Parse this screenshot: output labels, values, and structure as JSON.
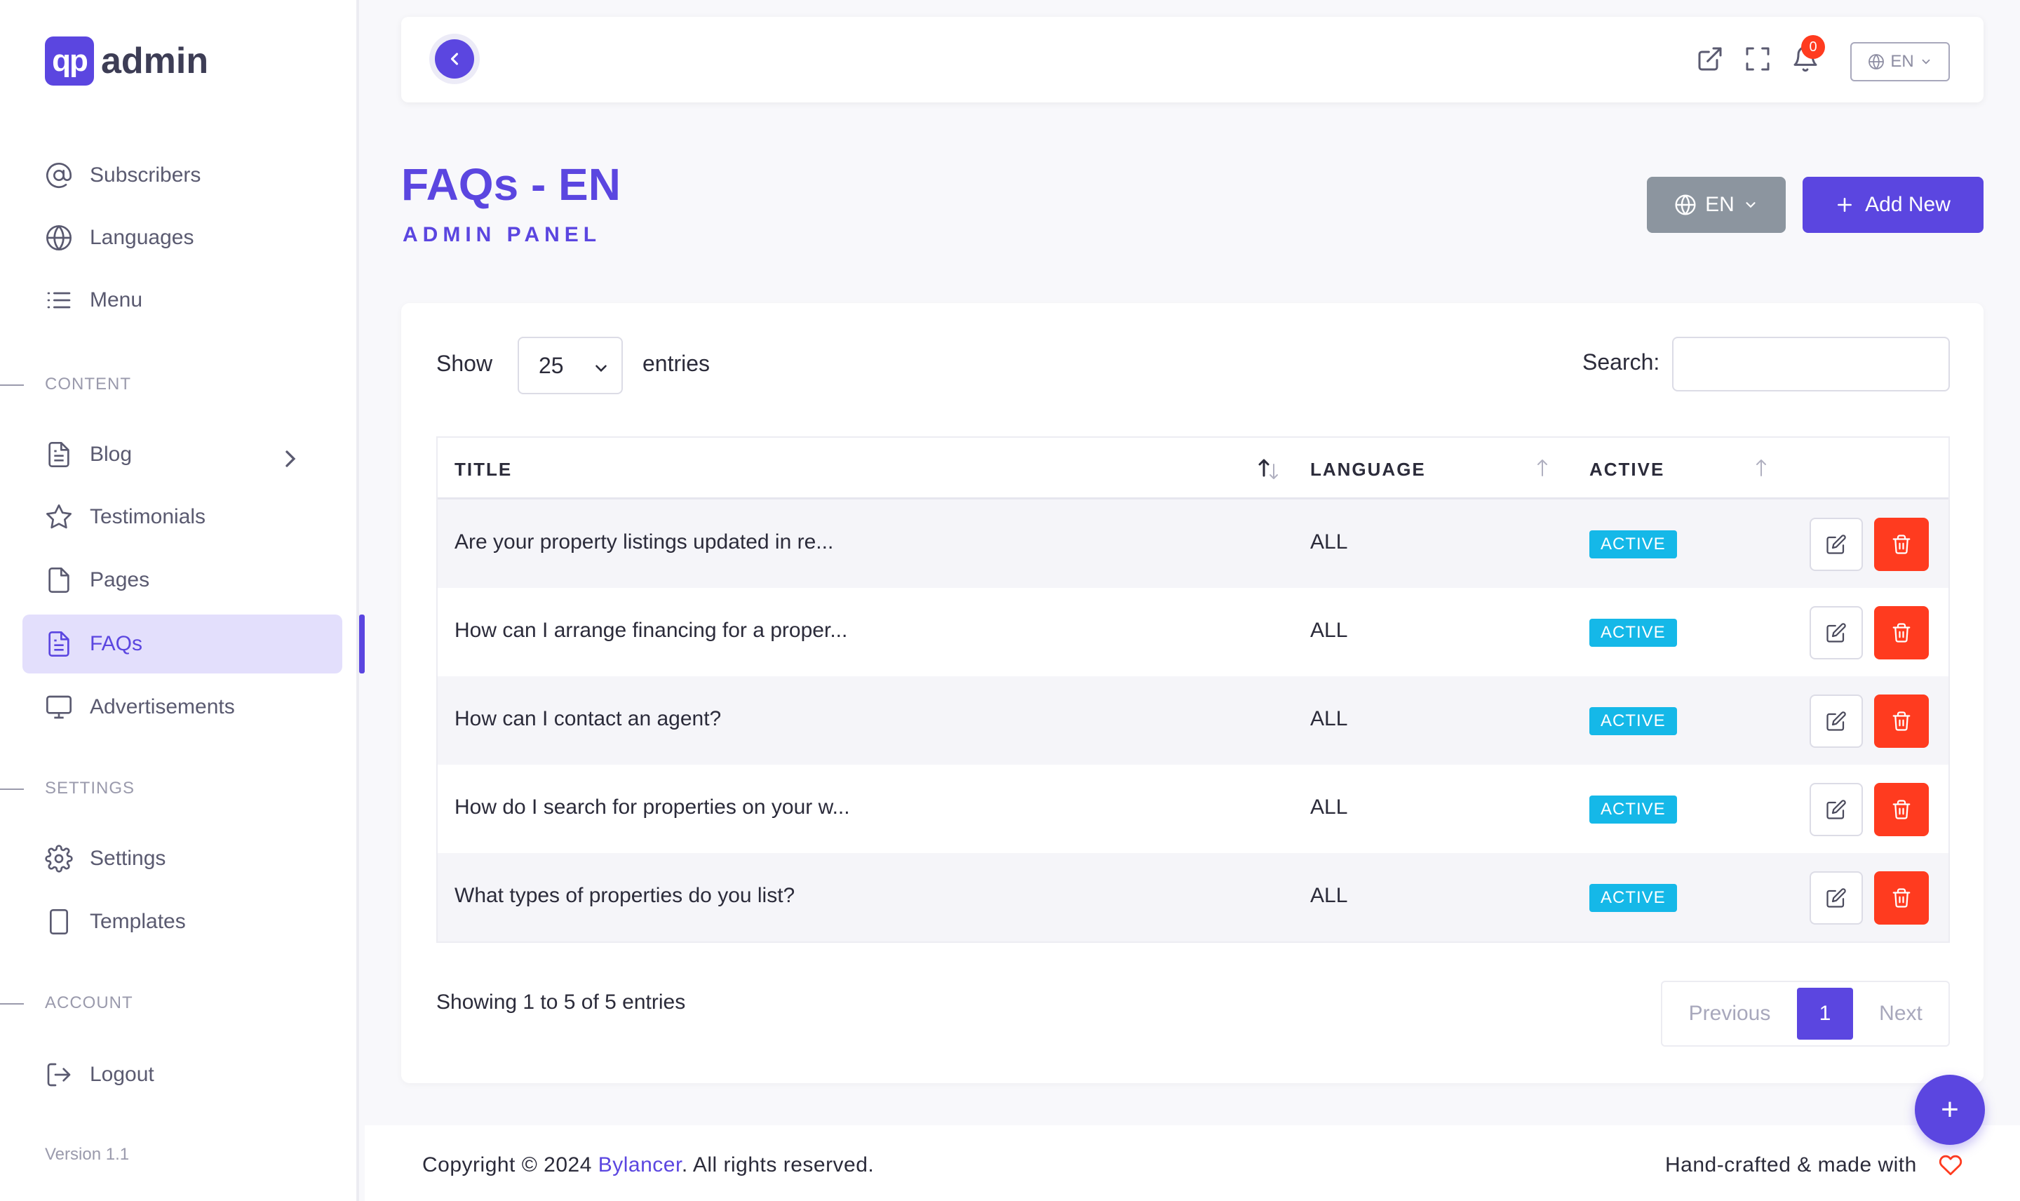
{
  "brand": {
    "logo_mark": "qp",
    "name": "admin"
  },
  "sidebar": {
    "items_top": [
      {
        "label": "Subscribers",
        "icon": "at-icon"
      },
      {
        "label": "Languages",
        "icon": "globe-icon"
      },
      {
        "label": "Menu",
        "icon": "list-icon"
      }
    ],
    "content_section": "CONTENT",
    "items_content": [
      {
        "label": "Blog",
        "icon": "document-icon"
      },
      {
        "label": "Testimonials",
        "icon": "star-icon"
      },
      {
        "label": "Pages",
        "icon": "page-icon"
      },
      {
        "label": "FAQs",
        "icon": "document-icon"
      },
      {
        "label": "Advertisements",
        "icon": "monitor-icon"
      }
    ],
    "settings_section": "SETTINGS",
    "items_settings": [
      {
        "label": "Settings",
        "icon": "gear-icon"
      },
      {
        "label": "Templates",
        "icon": "tablet-icon"
      }
    ],
    "account_section": "ACCOUNT",
    "items_account": [
      {
        "label": "Logout",
        "icon": "logout-icon"
      }
    ],
    "version": "Version 1.1"
  },
  "topbar": {
    "notification_count": "0",
    "language": "EN"
  },
  "header": {
    "title": "FAQs - EN",
    "subtitle": "ADMIN PANEL",
    "language_button": "EN",
    "add_button": "Add New"
  },
  "table_controls": {
    "show_label": "Show",
    "entries_value": "25",
    "entries_label": "entries",
    "search_label": "Search:",
    "search_value": ""
  },
  "table": {
    "columns": [
      "TITLE",
      "LANGUAGE",
      "ACTIVE"
    ],
    "rows": [
      {
        "title": "Are your property listings updated in re...",
        "language": "ALL",
        "status": "ACTIVE"
      },
      {
        "title": "How can I arrange financing for a proper...",
        "language": "ALL",
        "status": "ACTIVE"
      },
      {
        "title": "How can I contact an agent?",
        "language": "ALL",
        "status": "ACTIVE"
      },
      {
        "title": "How do I search for properties on your w...",
        "language": "ALL",
        "status": "ACTIVE"
      },
      {
        "title": "What types of properties do you list?",
        "language": "ALL",
        "status": "ACTIVE"
      }
    ]
  },
  "pagination": {
    "info": "Showing 1 to 5 of 5 entries",
    "previous": "Previous",
    "current": "1",
    "next": "Next"
  },
  "fab": {
    "label": "+"
  },
  "footer": {
    "copyright_prefix": "Copyright © 2024 ",
    "company": "Bylancer",
    "copyright_suffix": ". All rights reserved.",
    "handcrafted": "Hand-crafted & made with"
  },
  "colors": {
    "accent": "#5b46e0",
    "active_badge": "#15b8e8",
    "danger": "#ff3b1f",
    "language_button": "#8c959f"
  }
}
